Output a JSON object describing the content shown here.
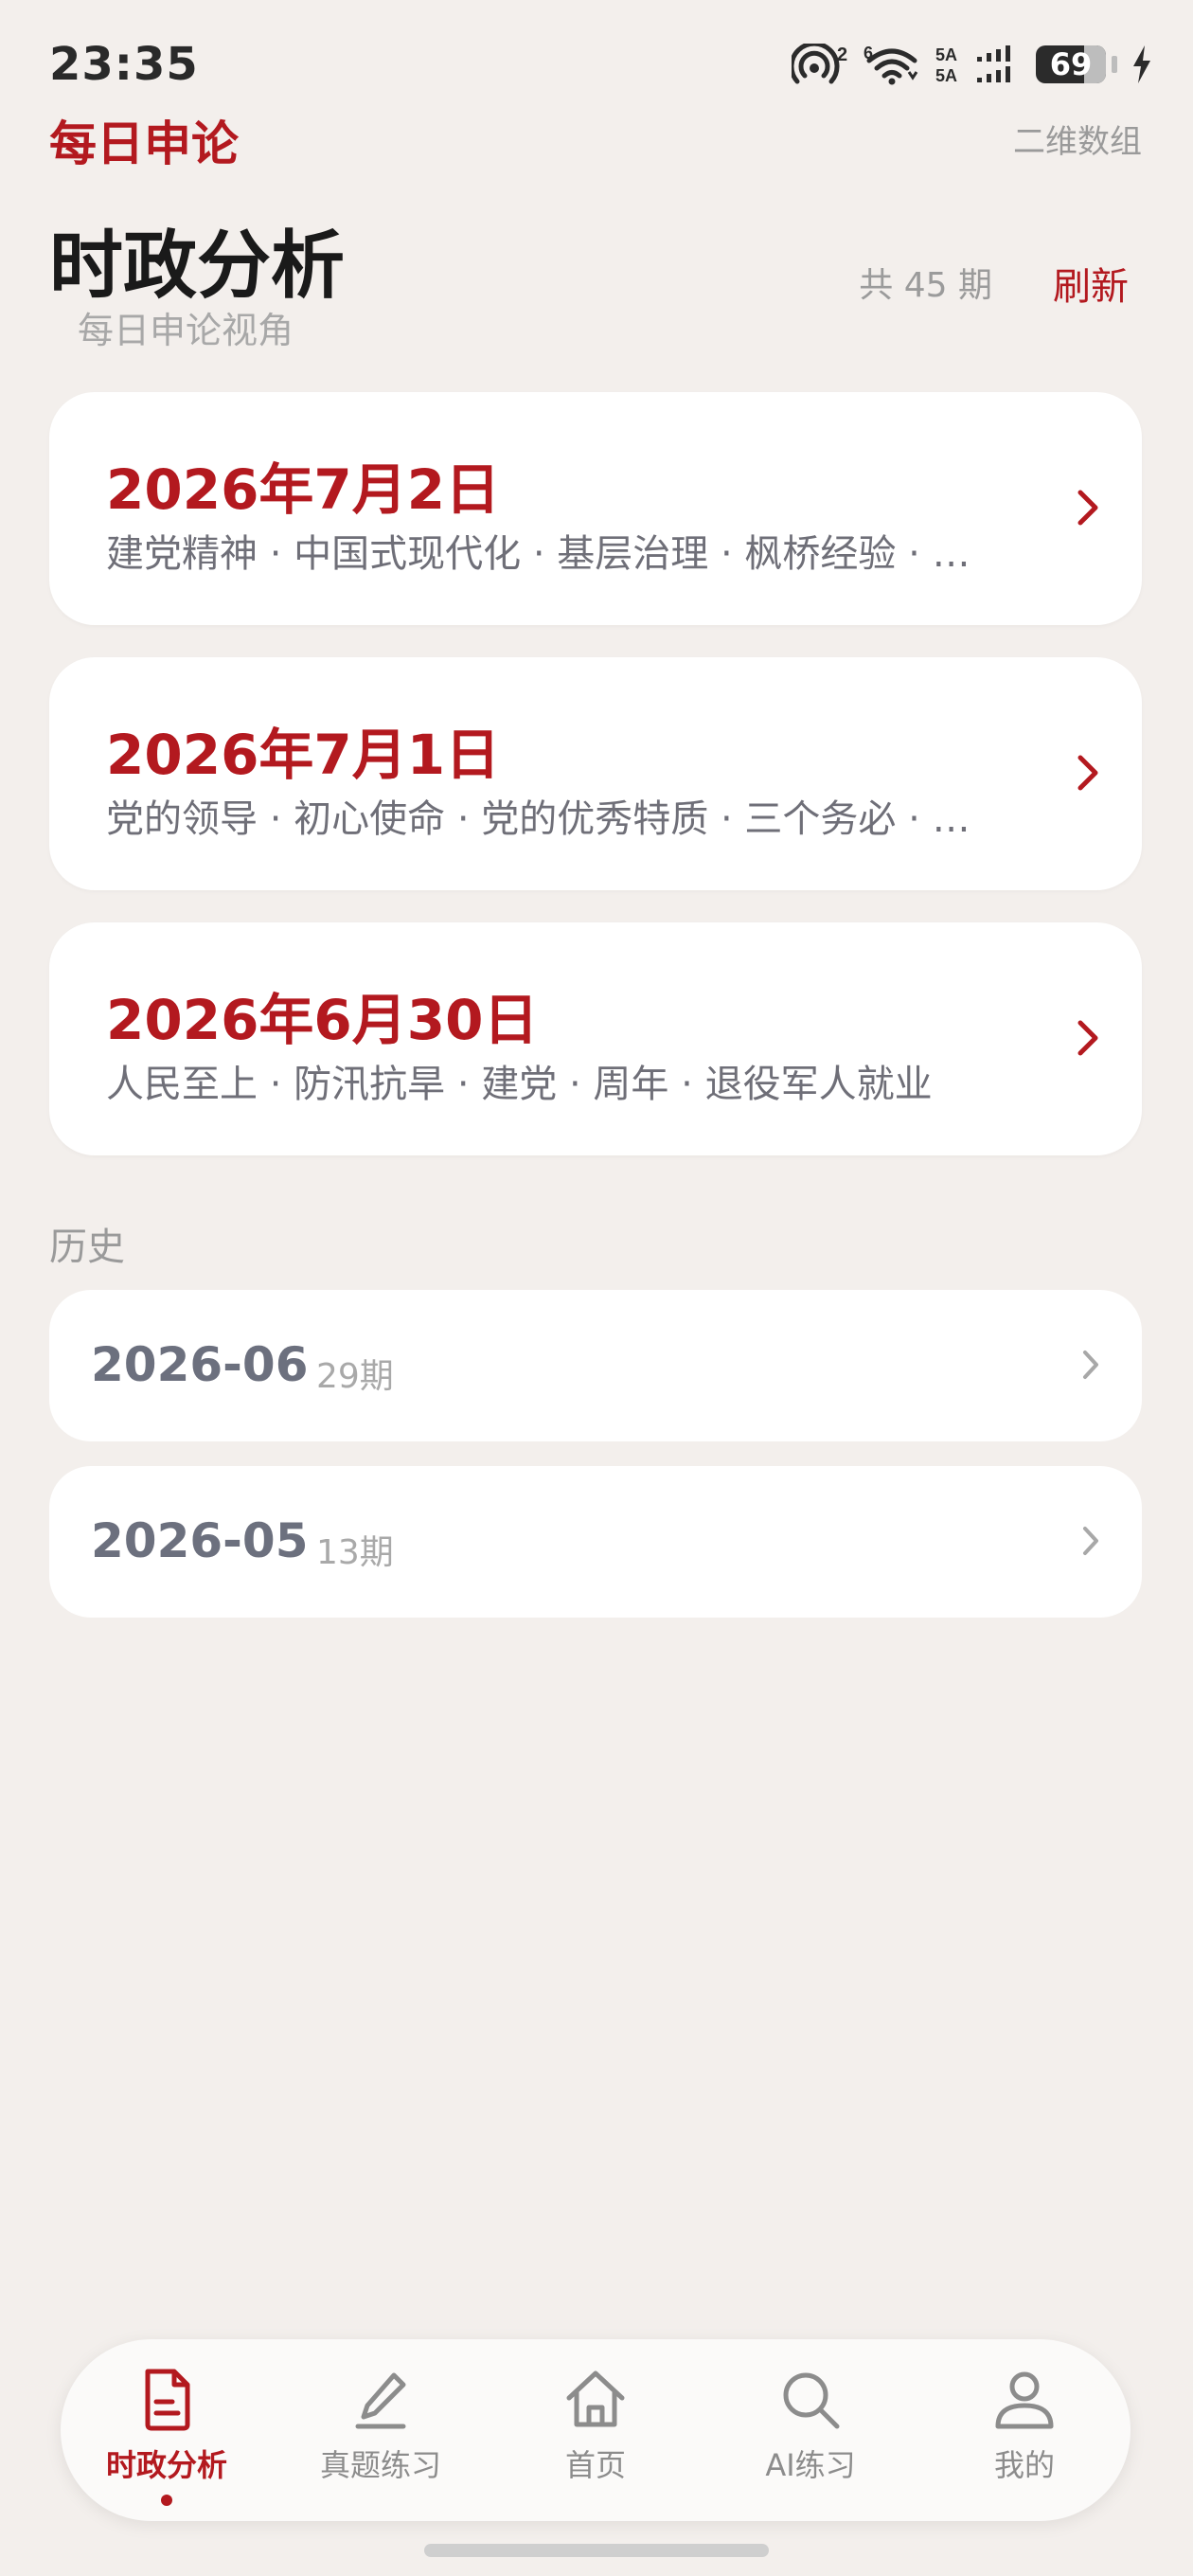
{
  "status_bar": {
    "time": "23:35",
    "battery": "69",
    "battery_level": 0.69,
    "icons": [
      "hotspot-icon",
      "wifi-icon",
      "signal-icon",
      "battery-icon",
      "charging-icon"
    ]
  },
  "header": {
    "app_name": "每日申论",
    "action": "二维数组"
  },
  "page": {
    "title": "时政分析",
    "subtitle": "每日申论视角",
    "count": "共 45 期",
    "refresh": "刷新"
  },
  "issues": [
    {
      "date": "2026年7月2日",
      "topics": "建党精神 · 中国式现代化 · 基层治理 · 枫桥经验 · …"
    },
    {
      "date": "2026年7月1日",
      "topics": "党的领导 · 初心使命 · 党的优秀特质 · 三个务必 · …"
    },
    {
      "date": "2026年6月30日",
      "topics": "人民至上 · 防汛抗旱 · 建党 · 周年 · 退役军人就业"
    }
  ],
  "history": {
    "label": "历史",
    "months": [
      {
        "month": "2026-06",
        "count": "29期"
      },
      {
        "month": "2026-05",
        "count": "13期"
      }
    ]
  },
  "tabbar": {
    "tabs": [
      {
        "label": "时政分析",
        "icon": "document-icon",
        "active": true
      },
      {
        "label": "真题练习",
        "icon": "pen-icon",
        "active": false
      },
      {
        "label": "首页",
        "icon": "home-icon",
        "active": false
      },
      {
        "label": "AI练习",
        "icon": "search-icon",
        "active": false
      },
      {
        "label": "我的",
        "icon": "person-icon",
        "active": false
      }
    ]
  },
  "colors": {
    "accent": "#B3191F",
    "background": "#F3EFEC",
    "card": "#FFFFFF",
    "muted": "#9A9A9A"
  }
}
